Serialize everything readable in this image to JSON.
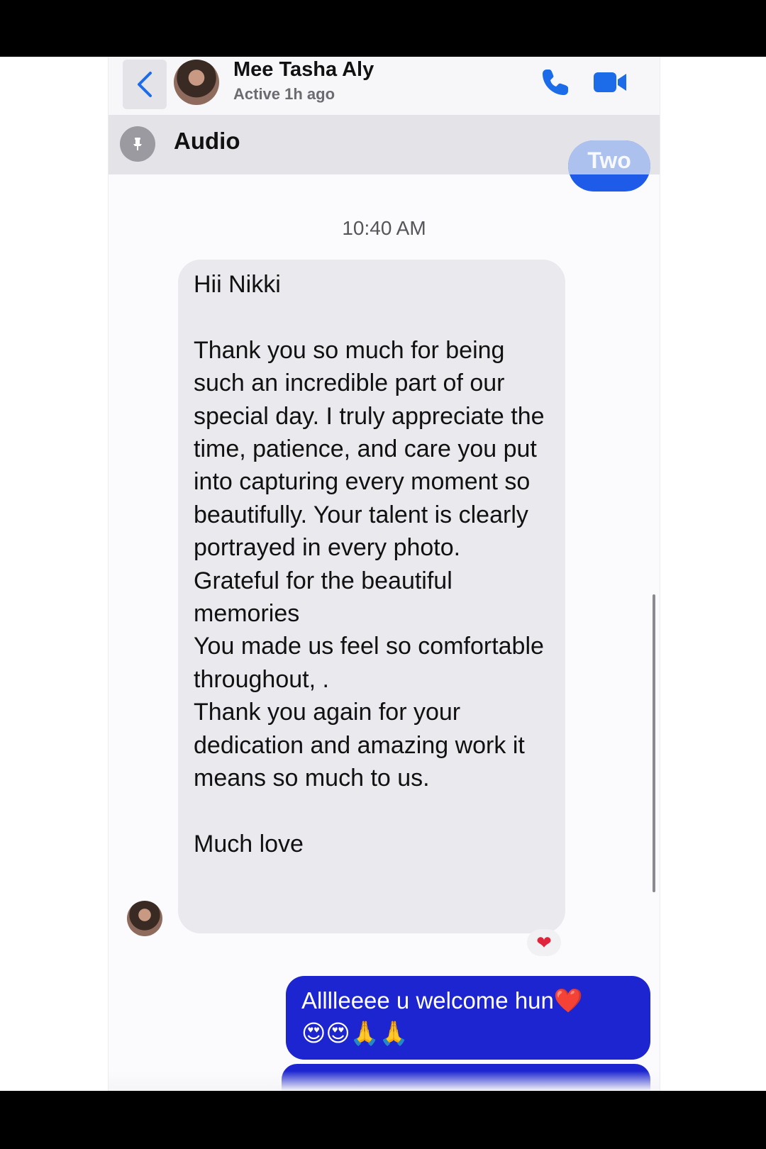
{
  "header": {
    "contact_name": "Mee Tasha Aly",
    "status": "Active 1h ago",
    "icons": {
      "back": "chevron-left-icon",
      "call": "phone-icon",
      "video": "video-camera-icon"
    }
  },
  "pinned": {
    "label": "Audio",
    "icon": "pin-icon"
  },
  "peek_bubble_text": "Two",
  "conversation": {
    "timestamp": "10:40 AM",
    "incoming_message": "Hii Nikki\n\nThank you so much for being such an incredible part of our special day. I truly appreciate the time, patience, and care you put into capturing every moment so beautifully. Your talent is clearly portrayed in every photo. Grateful for the beautiful memories\nYou made us feel so comfortable throughout, .\nThank you again for your dedication and amazing work it means so much to us.\n\nMuch love",
    "reaction": "❤",
    "outgoing_message": "Alllleeee u welcome hun❤️\n😍😍🙏🙏"
  },
  "colors": {
    "accent_blue": "#1c6be8",
    "outgoing_bubble": "#1c25cf",
    "incoming_bubble": "#e9e9ee"
  }
}
